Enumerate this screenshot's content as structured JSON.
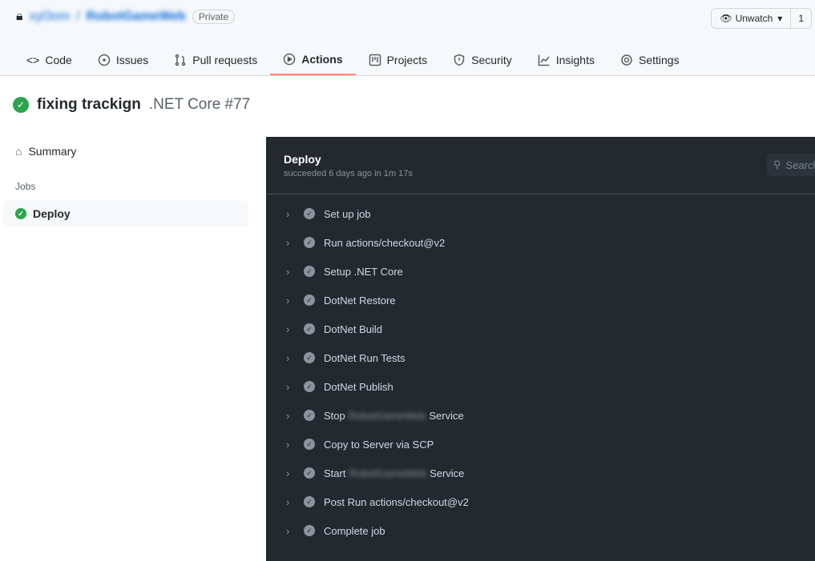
{
  "repo": {
    "owner": "xyl3om",
    "name": "RobotGameWeb",
    "visibility": "Private"
  },
  "watch": {
    "label": "Unwatch",
    "count": "1"
  },
  "tabs": [
    {
      "label": "Code"
    },
    {
      "label": "Issues"
    },
    {
      "label": "Pull requests"
    },
    {
      "label": "Actions"
    },
    {
      "label": "Projects"
    },
    {
      "label": "Security"
    },
    {
      "label": "Insights"
    },
    {
      "label": "Settings"
    }
  ],
  "run": {
    "title": "fixing trackign",
    "workflow": ".NET Core #77"
  },
  "sidebar": {
    "summary": "Summary",
    "jobs_heading": "Jobs",
    "job": "Deploy"
  },
  "job": {
    "name": "Deploy",
    "status": "succeeded 6 days ago in 1m 17s",
    "search_placeholder": "Search logs"
  },
  "steps": [
    {
      "pre": "Set up job"
    },
    {
      "pre": "Run actions/checkout@v2"
    },
    {
      "pre": "Setup .NET Core"
    },
    {
      "pre": "DotNet Restore"
    },
    {
      "pre": "DotNet Build"
    },
    {
      "pre": "DotNet Run Tests"
    },
    {
      "pre": "DotNet Publish"
    },
    {
      "pre": "Stop",
      "hidden": "RobotGameWeb",
      "post": "Service"
    },
    {
      "pre": "Copy to Server via SCP"
    },
    {
      "pre": "Start",
      "hidden": "RobotGameWeb",
      "post": "Service"
    },
    {
      "pre": "Post Run actions/checkout@v2"
    },
    {
      "pre": "Complete job"
    }
  ]
}
